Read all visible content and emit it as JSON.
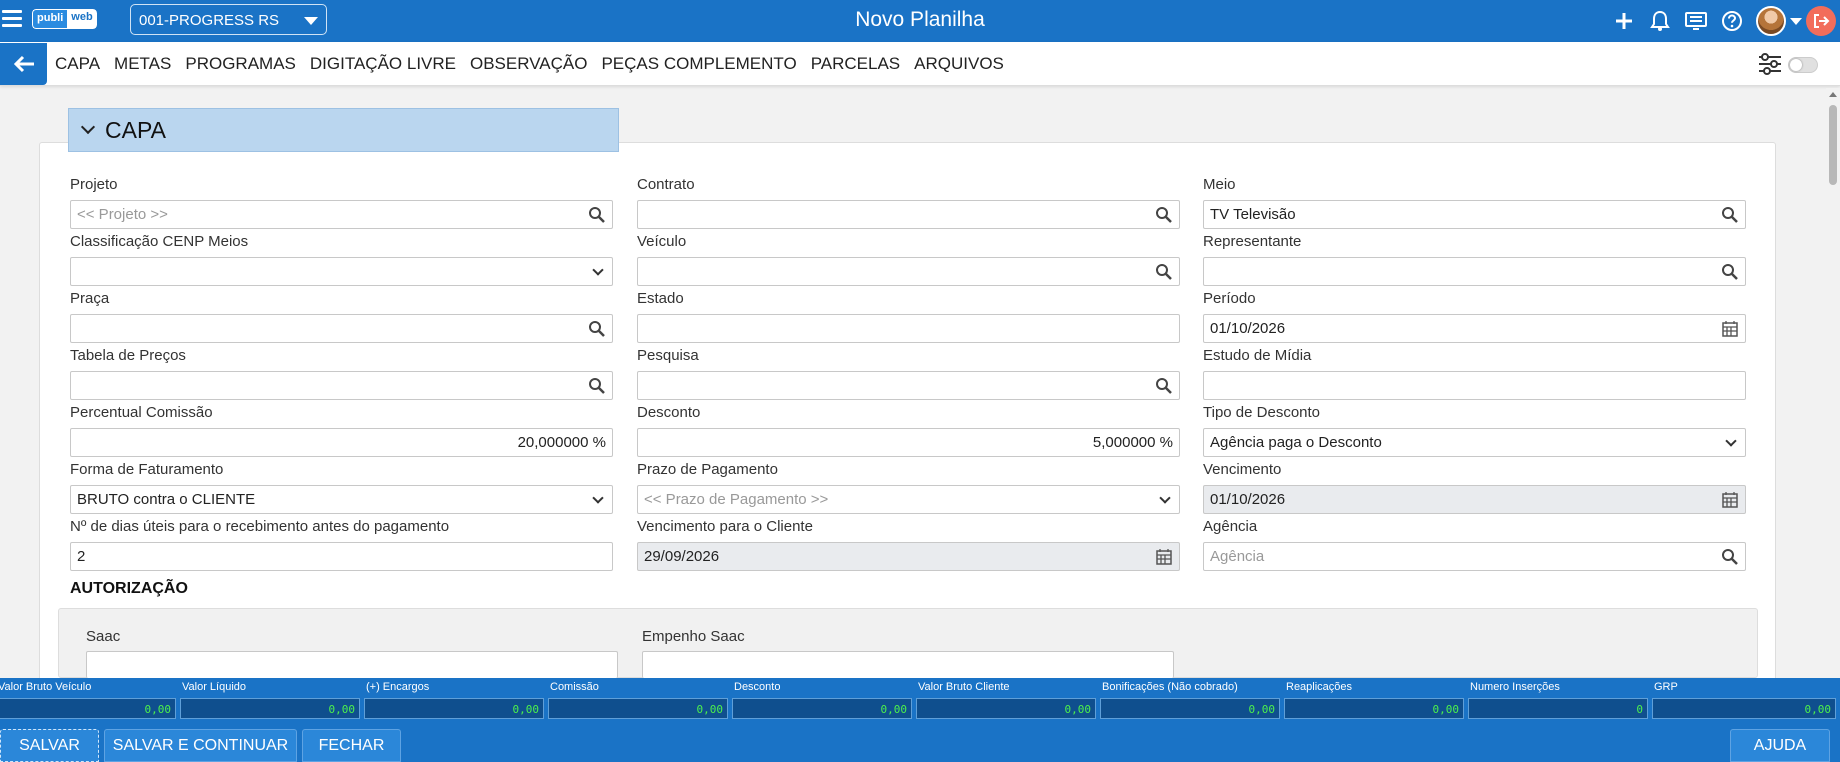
{
  "app": {
    "logo_left": "publi",
    "logo_right": "web",
    "company": "001-PROGRESS RS",
    "title": "Novo Planilha"
  },
  "tabs": [
    "CAPA",
    "METAS",
    "PROGRAMAS",
    "DIGITAÇÃO LIVRE",
    "OBSERVAÇÃO",
    "PEÇAS COMPLEMENTO",
    "PARCELAS",
    "ARQUIVOS"
  ],
  "section": {
    "title": "CAPA"
  },
  "fields": {
    "projeto": {
      "label": "Projeto",
      "placeholder": "<< Projeto >>",
      "value": ""
    },
    "contrato": {
      "label": "Contrato",
      "value": ""
    },
    "meio": {
      "label": "Meio",
      "value": "TV Televisão"
    },
    "classificacao": {
      "label": "Classificação CENP Meios",
      "value": ""
    },
    "veiculo": {
      "label": "Veículo",
      "value": ""
    },
    "representante": {
      "label": "Representante",
      "value": ""
    },
    "praca": {
      "label": "Praça",
      "value": ""
    },
    "estado": {
      "label": "Estado",
      "value": ""
    },
    "periodo": {
      "label": "Período",
      "value": "01/10/2026"
    },
    "tabela": {
      "label": "Tabela de Preços",
      "value": ""
    },
    "pesquisa": {
      "label": "Pesquisa",
      "value": ""
    },
    "estudo": {
      "label": "Estudo de Mídia",
      "value": ""
    },
    "percentual": {
      "label": "Percentual Comissão",
      "value": "20,000000 %"
    },
    "desconto": {
      "label": "Desconto",
      "value": "5,000000 %"
    },
    "tipo_desconto": {
      "label": "Tipo de Desconto",
      "value": "Agência paga o Desconto"
    },
    "forma": {
      "label": "Forma de Faturamento",
      "value": "BRUTO contra o CLIENTE"
    },
    "prazo": {
      "label": "Prazo de Pagamento",
      "placeholder": "<< Prazo de Pagamento >>",
      "value": ""
    },
    "vencimento": {
      "label": "Vencimento",
      "value": "01/10/2026"
    },
    "dias": {
      "label": "Nº de dias úteis para o recebimento antes do pagamento",
      "value": "2"
    },
    "venc_cliente": {
      "label": "Vencimento para o Cliente",
      "value": "29/09/2026"
    },
    "agencia": {
      "label": "Agência",
      "placeholder": "Agência",
      "value": ""
    }
  },
  "autorizacao": {
    "title": "AUTORIZAÇÃO",
    "saac": {
      "label": "Saac"
    },
    "empenho": {
      "label": "Empenho Saac"
    }
  },
  "totals": [
    {
      "label": "Valor Bruto Veículo",
      "value": "0,00"
    },
    {
      "label": "Valor Líquido",
      "value": "0,00"
    },
    {
      "label": "(+) Encargos",
      "value": "0,00"
    },
    {
      "label": "Comissão",
      "value": "0,00"
    },
    {
      "label": "Desconto",
      "value": "0,00"
    },
    {
      "label": "Valor Bruto Cliente",
      "value": "0,00"
    },
    {
      "label": "Bonificações (Não cobrado)",
      "value": "0,00"
    },
    {
      "label": "Reaplicações",
      "value": "0,00"
    },
    {
      "label": "Numero Inserções",
      "value": "0"
    },
    {
      "label": "GRP",
      "value": "0,00"
    }
  ],
  "buttons": {
    "salvar": "SALVAR",
    "salvar_continuar": "SALVAR E CONTINUAR",
    "fechar": "FECHAR",
    "ajuda": "AJUDA"
  },
  "colors": {
    "primary": "#1a73c6",
    "section_header": "#bad6ef",
    "totals_value_text": "#4cf04c"
  }
}
